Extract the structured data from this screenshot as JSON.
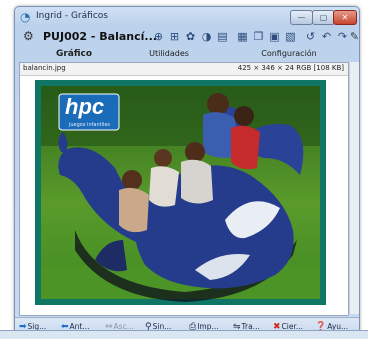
{
  "window": {
    "title": "Ingrid - Gráficos",
    "controls": {
      "minimize": "—",
      "maximize": "▢",
      "close": "✕"
    }
  },
  "toolbar": {
    "doc_title": "PUJ002 - Balancí...",
    "tools": [
      "zoom-in-icon",
      "crosshair-icon",
      "palette-icon",
      "contrast-icon",
      "page-icon",
      "print-icon",
      "copy-icon",
      "save-icon",
      "document-icon",
      "rotate-left-icon",
      "undo-icon",
      "redo-icon",
      "pencil-icon"
    ]
  },
  "tabs": [
    "Gráfico",
    "Utilidades",
    "Configuración"
  ],
  "file": {
    "name": "balancin.jpg",
    "info": "425 × 346 × 24 RGB [108 KB]"
  },
  "image": {
    "logo": "hpc",
    "logo_sub": "juegos infantiles"
  },
  "bottom_buttons": [
    {
      "label": "Sig...",
      "icon": "arrow-right-icon"
    },
    {
      "label": "Ant...",
      "icon": "arrow-left-icon"
    },
    {
      "label": "Asc...",
      "icon": "ascend-icon"
    },
    {
      "label": "Sin...",
      "icon": "sin-icon"
    },
    {
      "label": "Imp...",
      "icon": "printer-icon"
    },
    {
      "label": "Tra...",
      "icon": "transfer-icon"
    },
    {
      "label": "Cier...",
      "icon": "close-x-icon"
    },
    {
      "label": "Ayu...",
      "icon": "help-icon"
    }
  ],
  "colors": {
    "frame": "#0f7565",
    "seat_blue": "#253b8c",
    "grass": "#3f8a22"
  }
}
